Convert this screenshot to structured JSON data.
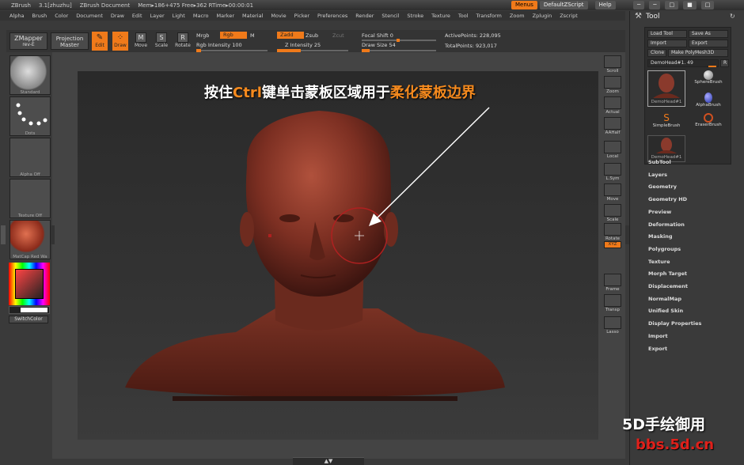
{
  "titlebar": {
    "app": "ZBrush",
    "version": "3.1[zhuzhu]",
    "document": "ZBrush Document",
    "mem": "Mem▸186+475 Free▸362 RTime▸00:00:01",
    "menus_label": "Menus",
    "script_label": "DefaultZScript",
    "help_label": "Help"
  },
  "menubar": [
    "Alpha",
    "Brush",
    "Color",
    "Document",
    "Draw",
    "Edit",
    "Layer",
    "Light",
    "Macro",
    "Marker",
    "Material",
    "Movie",
    "Picker",
    "Preferences",
    "Render",
    "Stencil",
    "Stroke",
    "Texture",
    "Tool",
    "Transform",
    "Zoom",
    "Zplugin",
    "Zscript"
  ],
  "toolbar": {
    "zmapper": "ZMapper",
    "zmapper_sub": "rev-E",
    "projection": "Projection",
    "projection_sub": "Master",
    "edit": "Edit",
    "draw": "Draw",
    "move": "Move",
    "scale": "Scale",
    "rotate": "Rotate",
    "mrgb": "Mrgb",
    "rgb": "Rgb",
    "m": "M",
    "rgb_intensity": "Rgb Intensity 100",
    "zadd": "Zadd",
    "zsub": "Zsub",
    "zcut": "Zcut",
    "z_intensity": "Z Intensity 25",
    "focal_shift": "Focal Shift 0",
    "draw_size": "Draw Size 54",
    "active_points": "ActivePoints: 228,095",
    "total_points": "TotalPoints: 923,017"
  },
  "leftshelf": {
    "standard": "Standard",
    "dots": "Dots",
    "alpha_off": "Alpha Off",
    "texture_off": "Texture Off",
    "matcap": "MatCap Red Wa",
    "switch_color": "SwitchColor"
  },
  "rightshelf": [
    "Scroll",
    "Zoom",
    "Actual",
    "AAHalf",
    "Local",
    "L.Sym",
    "Move",
    "Scale",
    "Rotate",
    "XYZ",
    "Frame",
    "Transp",
    "Lasso"
  ],
  "tool_panel": {
    "title": "Tool",
    "load_tool": "Load Tool",
    "save_as": "Save As",
    "import": "Import",
    "export": "Export",
    "clone": "Clone",
    "make_polymesh": "Make PolyMesh3D",
    "current_tool": "DemoHead#1. 49",
    "r": "R",
    "tools": [
      "DemoHead#1",
      "SphereBrush",
      "AlphaBrush",
      "SimpleBrush",
      "EraserBrush",
      "DemoHead#1"
    ],
    "subpalettes": [
      "SubTool",
      "Layers",
      "Geometry",
      "Geometry HD",
      "Preview",
      "Deformation",
      "Masking",
      "Polygroups",
      "Texture",
      "Morph Target",
      "Displacement",
      "NormalMap",
      "Unified Skin",
      "Display Properties",
      "Import",
      "Export"
    ]
  },
  "annotation": {
    "part1": "按住",
    "key": "Ctrl",
    "part2": "键单击蒙板区域用于",
    "highlight": "柔化蒙板边界"
  },
  "watermark": {
    "line1": "5D手绘御用",
    "line2": "bbs.5d.cn"
  },
  "colors": {
    "accent": "#f07a1a",
    "skin": "#8a3a2c"
  }
}
